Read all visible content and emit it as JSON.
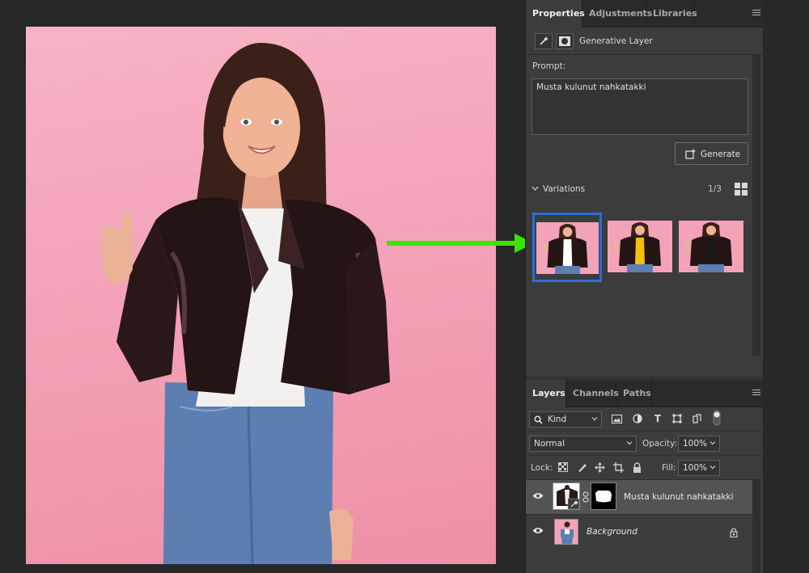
{
  "canvas": {
    "arrow_color": "#39e600",
    "background_color": "#f3a3b7"
  },
  "properties_panel": {
    "tabs": [
      {
        "label": "Properties",
        "active": true
      },
      {
        "label": "Adjustments",
        "active": false
      },
      {
        "label": "Libraries",
        "active": false
      }
    ],
    "layer_type_label": "Generative Layer",
    "prompt_label": "Prompt:",
    "prompt_value": "Musta kulunut nahkatakki",
    "generate_button": "Generate",
    "variations_label": "Variations",
    "variations_count": "1/3",
    "variations": [
      {
        "shirt_color": "#ffffff",
        "selected": true
      },
      {
        "shirt_color": "#f2c200",
        "selected": false
      },
      {
        "shirt_color": "#1a1a1a",
        "selected": false
      }
    ],
    "selection_color": "#2a6ed8"
  },
  "layers_panel": {
    "tabs": [
      {
        "label": "Layers",
        "active": true
      },
      {
        "label": "Channels",
        "active": false
      },
      {
        "label": "Paths",
        "active": false
      }
    ],
    "filter_kind": "Kind",
    "blend_mode": "Normal",
    "opacity_label": "Opacity:",
    "opacity_value": "100%",
    "lock_label": "Lock:",
    "fill_label": "Fill:",
    "fill_value": "100%",
    "layers": [
      {
        "name": "Musta kulunut nahkatakki",
        "visible": true,
        "active": true,
        "italic": false
      },
      {
        "name": "Background",
        "visible": true,
        "active": false,
        "italic": true,
        "locked": true
      }
    ]
  }
}
